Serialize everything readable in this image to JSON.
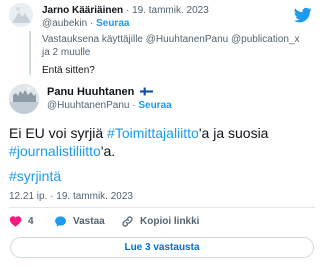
{
  "reply_tweet": {
    "name": "Jarno Kääriäinen",
    "separator": "·",
    "date": "19. tammik. 2023",
    "handle": "@aubekin",
    "follow_label": "Seuraa",
    "replying_prefix": "Vastauksena käyttäjille",
    "replying_mentions": "@HuuhtanenPanu @publication_x",
    "replying_suffix": "ja 2 muulle",
    "text": "Entä sitten?"
  },
  "main_tweet": {
    "name": "Panu Huuhtanen",
    "handle": "@HuuhtanenPanu",
    "separator": "·",
    "follow_label": "Seuraa",
    "text_1": "Ei EU voi syrjiä ",
    "hashtag_1": "#Toimittajaliitto",
    "text_2": "'a ja suosia ",
    "hashtag_2": "#journalistiliitto",
    "text_3": "'a.",
    "hashtag_3": "#syrjintä",
    "time": "12.21 ip.",
    "date": "19. tammik. 2023"
  },
  "actions": {
    "like_count": "4",
    "reply_label": "Vastaa",
    "copy_label": "Kopioi linkki"
  },
  "more_replies_label": "Lue 3 vastausta",
  "colors": {
    "accent": "#1d9bf0",
    "like": "#f91880",
    "text": "#0f1419",
    "muted": "#536471"
  }
}
